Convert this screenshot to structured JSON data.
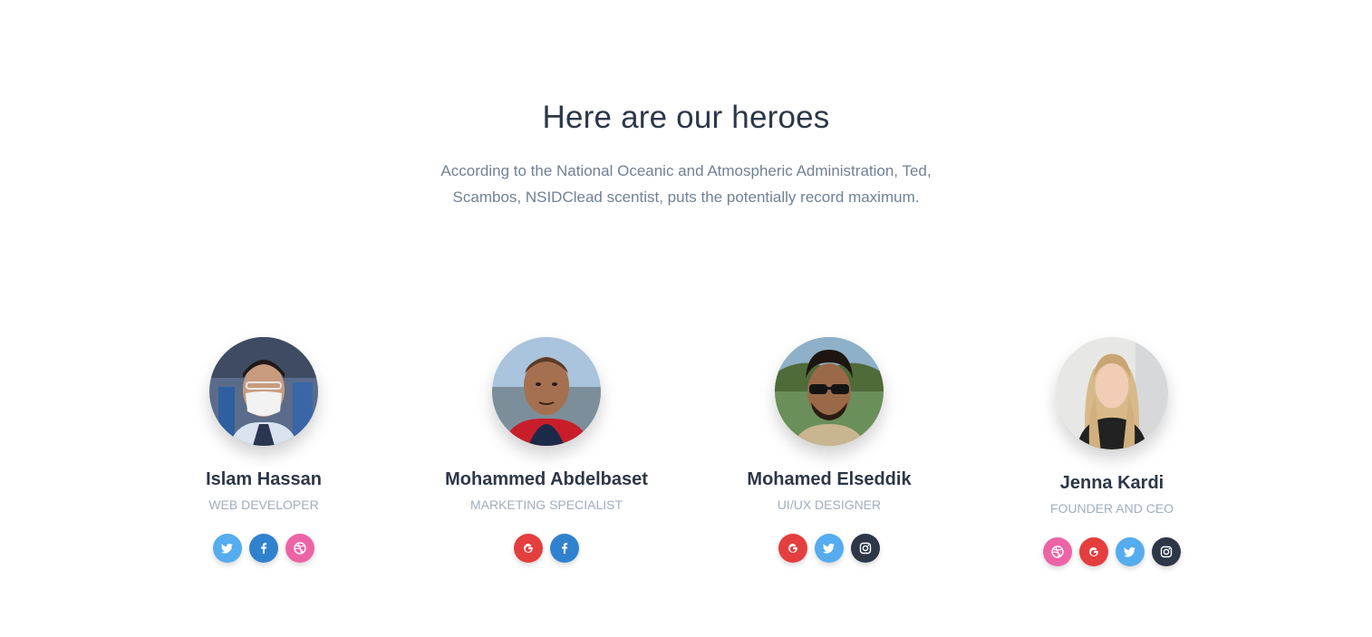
{
  "header": {
    "title": "Here are our heroes",
    "description": "According to the National Oceanic and Atmospheric Administration, Ted, Scambos, NSIDClead scentist, puts the potentially record maximum."
  },
  "members": [
    {
      "name": "Islam Hassan",
      "role": "Web Developer",
      "avatar": "photo-islam-hassan",
      "socials": [
        "twitter",
        "facebook",
        "dribbble"
      ]
    },
    {
      "name": "Mohammed Abdelbaset",
      "role": "Marketing Specialist",
      "avatar": "photo-mohammed-abdelbaset",
      "socials": [
        "google",
        "facebook"
      ]
    },
    {
      "name": "Mohamed Elseddik",
      "role": "UI/UX Designer",
      "avatar": "photo-mohamed-elseddik",
      "socials": [
        "google",
        "twitter",
        "instagram"
      ]
    },
    {
      "name": "Jenna Kardi",
      "role": "Founder and CEO",
      "avatar": "photo-jenna-kardi",
      "socials": [
        "dribbble",
        "google",
        "twitter",
        "instagram"
      ]
    }
  ],
  "social_colors": {
    "twitter": "#55acee",
    "facebook": "#3b5998",
    "dribbble": "#ea4c89",
    "google": "#e53e3e",
    "instagram": "#2d3748"
  },
  "icons": {
    "twitter": "twitter-icon",
    "facebook": "facebook-icon",
    "dribbble": "dribbble-icon",
    "google": "google-icon",
    "instagram": "instagram-icon"
  }
}
